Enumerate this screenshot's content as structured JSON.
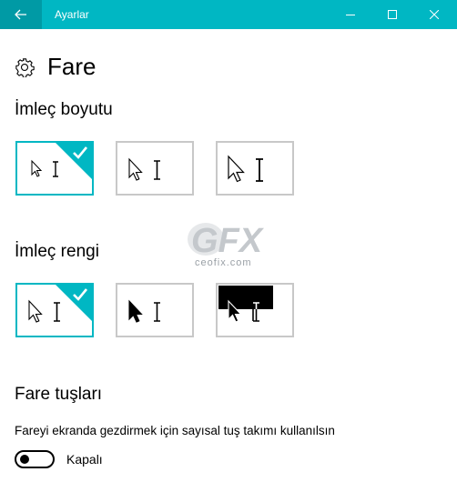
{
  "window": {
    "title": "Ayarlar",
    "accent_color": "#00b7c3"
  },
  "page": {
    "title": "Fare",
    "icon": "gear-icon"
  },
  "pointer_size": {
    "heading": "İmleç boyutu",
    "options": [
      {
        "size": "small",
        "selected": true
      },
      {
        "size": "medium",
        "selected": false
      },
      {
        "size": "large",
        "selected": false
      }
    ]
  },
  "pointer_color": {
    "heading": "İmleç rengi",
    "options": [
      {
        "style": "white",
        "selected": true
      },
      {
        "style": "black",
        "selected": false
      },
      {
        "style": "inverted",
        "selected": false
      }
    ]
  },
  "mouse_keys": {
    "heading": "Fare tuşları",
    "description": "Fareyi ekranda gezdirmek için sayısal tuş takımı kullanılsın",
    "toggle_state": "Kapalı",
    "toggle_on": false
  },
  "watermark": {
    "logo": "GFX",
    "text": "ceofix.com"
  }
}
